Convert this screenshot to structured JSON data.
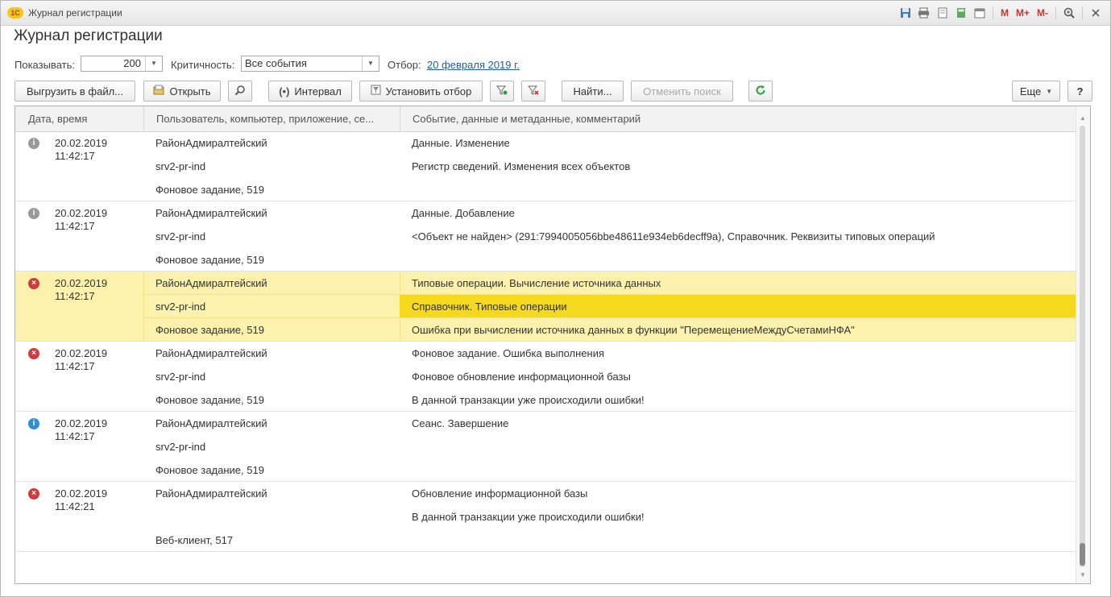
{
  "window": {
    "title": "Журнал регистрации",
    "logo": "1С",
    "toolbar_icons": [
      "save-icon",
      "print-icon",
      "preview-icon",
      "calculator-icon",
      "calendar-icon"
    ],
    "memory": {
      "m": "M",
      "m_plus": "M+",
      "m_minus": "M-"
    }
  },
  "page": {
    "title": "Журнал регистрации"
  },
  "filters": {
    "show_label": "Показывать:",
    "show_value": "200",
    "severity_label": "Критичность:",
    "severity_value": "Все события",
    "filter_label": "Отбор:",
    "filter_link": "20 февраля 2019 г."
  },
  "toolbar": {
    "export": "Выгрузить в файл...",
    "open": "Открыть",
    "interval": "Интервал",
    "set_filter": "Установить отбор",
    "find": "Найти...",
    "cancel_search": "Отменить поиск",
    "more": "Еще",
    "help": "?"
  },
  "grid": {
    "columns": [
      "Дата, время",
      "Пользователь, компьютер, приложение, се...",
      "Событие, данные и метаданные, комментарий"
    ],
    "rows": [
      {
        "level": "information",
        "icon": "info-gray-icon",
        "date": "20.02.2019",
        "time": "11:42:17",
        "user": "РайонАдмиралтейский",
        "computer": "srv2-pr-ind",
        "app": "Фоновое задание, 519",
        "event": "Данные. Изменение",
        "data": "Регистр сведений. Изменения всех объектов",
        "comment": ""
      },
      {
        "level": "information",
        "icon": "info-gray-icon",
        "date": "20.02.2019",
        "time": "11:42:17",
        "user": "РайонАдмиралтейский",
        "computer": "srv2-pr-ind",
        "app": "Фоновое задание, 519",
        "event": "Данные. Добавление",
        "data": "<Объект не найден> (291:7994005056bbe48611e934eb6decff9a), Справочник. Реквизиты типовых операций",
        "comment": ""
      },
      {
        "level": "error",
        "icon": "error-icon",
        "selected": true,
        "date": "20.02.2019",
        "time": "11:42:17",
        "user": "РайонАдмиралтейский",
        "computer": "srv2-pr-ind",
        "app": "Фоновое задание, 519",
        "event": "Типовые операции. Вычисление источника данных",
        "data": "Справочник. Типовые операции",
        "comment": "Ошибка при вычислении источника данных в функции \"ПеремещениеМеждуСчетамиНФА\""
      },
      {
        "level": "error",
        "icon": "error-icon",
        "date": "20.02.2019",
        "time": "11:42:17",
        "user": "РайонАдмиралтейский",
        "computer": "srv2-pr-ind",
        "app": "Фоновое задание, 519",
        "event": "Фоновое задание. Ошибка выполнения",
        "data": "Фоновое обновление информационной базы",
        "comment": "В данной транзакции уже происходили ошибки!"
      },
      {
        "level": "note",
        "icon": "info-blue-icon",
        "date": "20.02.2019",
        "time": "11:42:17",
        "user": "РайонАдмиралтейский",
        "computer": "srv2-pr-ind",
        "app": "Фоновое задание, 519",
        "event": "Сеанс. Завершение",
        "data": "",
        "comment": ""
      },
      {
        "level": "error",
        "icon": "error-icon",
        "date": "20.02.2019",
        "time": "11:42:21",
        "user": "РайонАдмиралтейский",
        "computer": "",
        "app": "Веб-клиент, 517",
        "event": "Обновление информационной базы",
        "data": "В данной транзакции уже происходили ошибки!",
        "comment": ""
      }
    ]
  },
  "colors": {
    "selected_row": "#fcf2ae",
    "selected_cell": "#f5d91c",
    "error": "#d23b3b",
    "info_gray": "#9a9a9a",
    "info_blue": "#2f8fd0",
    "link": "#1f5fa8"
  }
}
